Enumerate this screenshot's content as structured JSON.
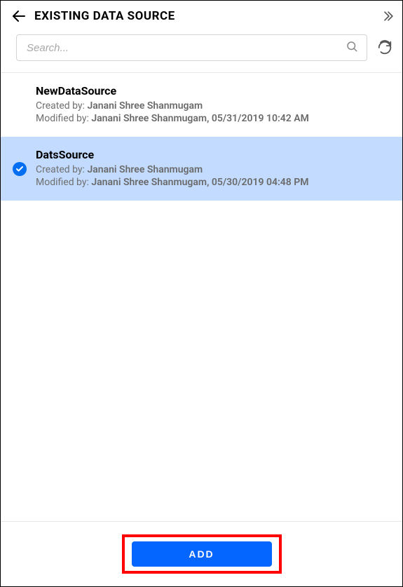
{
  "header": {
    "title": "EXISTING DATA SOURCE"
  },
  "search": {
    "placeholder": "Search..."
  },
  "items": [
    {
      "name": "NewDataSource",
      "created_label": "Created by:",
      "created_by": "Janani Shree Shanmugam",
      "modified_label": "Modified by:",
      "modified_by": "Janani Shree Shanmugam, 05/31/2019 10:42 AM",
      "selected": false
    },
    {
      "name": "DatsSource",
      "created_label": "Created by:",
      "created_by": "Janani Shree Shanmugam",
      "modified_label": "Modified by:",
      "modified_by": "Janani Shree Shanmugam, 05/30/2019 04:48 PM",
      "selected": true
    }
  ],
  "footer": {
    "add_label": "ADD"
  }
}
